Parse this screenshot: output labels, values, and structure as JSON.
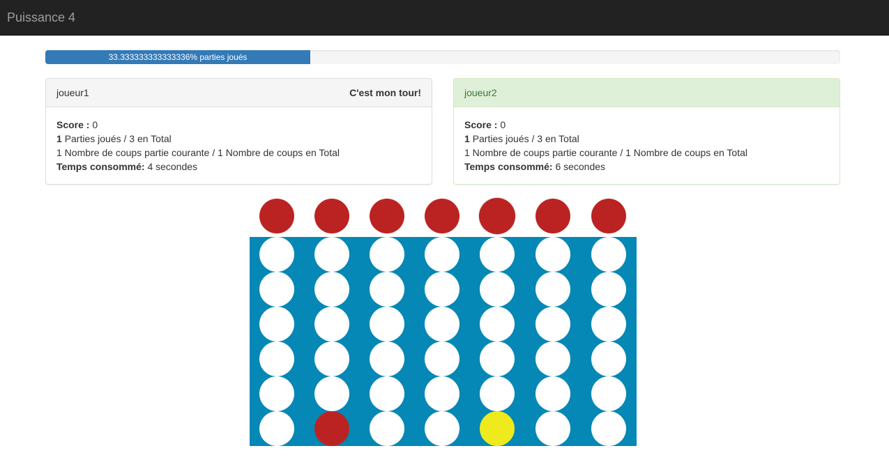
{
  "app": {
    "title": "Puissance 4"
  },
  "progress": {
    "percent": 33.333333333333336,
    "label": "33.333333333333336% parties joués"
  },
  "players": [
    {
      "name": "joueur1",
      "turn_label": "C'est mon tour!",
      "score_label": "Score :",
      "score": "0",
      "games_played": "1",
      "games_text": "Parties joués / 3 en Total",
      "moves_text": "1 Nombre de coups partie courante / 1 Nombre de coups en Total",
      "time_label": "Temps consommé:",
      "time_value": "4 secondes"
    },
    {
      "name": "joueur2",
      "turn_label": "",
      "score_label": "Score :",
      "score": "0",
      "games_played": "1",
      "games_text": "Parties joués / 3 en Total",
      "moves_text": "1 Nombre de coups partie courante / 1 Nombre de coups en Total",
      "time_label": "Temps consommé:",
      "time_value": "6 secondes"
    }
  ],
  "board": {
    "columns": 7,
    "rows": 6,
    "hovered_column": 4,
    "drop_token_color": "red",
    "grid": [
      [
        "empty",
        "empty",
        "empty",
        "empty",
        "empty",
        "empty",
        "empty"
      ],
      [
        "empty",
        "empty",
        "empty",
        "empty",
        "empty",
        "empty",
        "empty"
      ],
      [
        "empty",
        "empty",
        "empty",
        "empty",
        "empty",
        "empty",
        "empty"
      ],
      [
        "empty",
        "empty",
        "empty",
        "empty",
        "empty",
        "empty",
        "empty"
      ],
      [
        "empty",
        "empty",
        "empty",
        "empty",
        "empty",
        "empty",
        "empty"
      ],
      [
        "empty",
        "red",
        "empty",
        "empty",
        "yellow",
        "empty",
        "empty"
      ]
    ]
  },
  "colors": {
    "navbar": "#222222",
    "board": "#0588b5",
    "red": "#bb2323",
    "yellow": "#eeea1e",
    "empty": "#ffffff",
    "progress": "#337ab7"
  }
}
